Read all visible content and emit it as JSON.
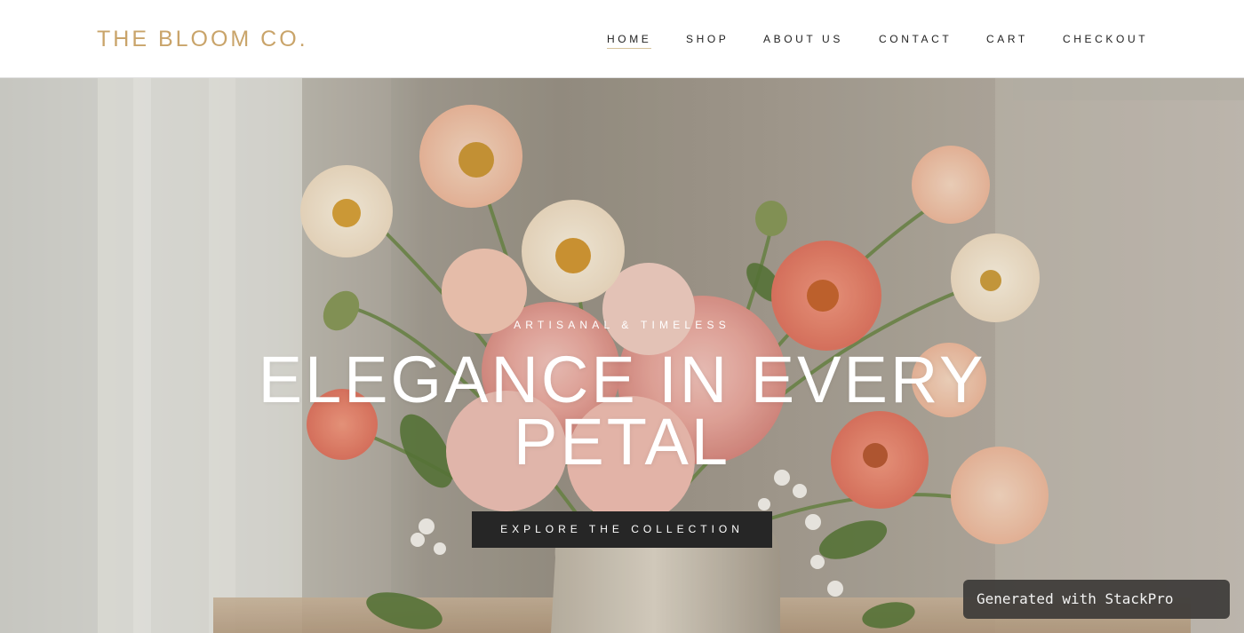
{
  "brand": {
    "name": "THE BLOOM CO.",
    "color": "#c9a46a"
  },
  "nav": {
    "items": [
      {
        "label": "HOME",
        "active": true
      },
      {
        "label": "SHOP",
        "active": false
      },
      {
        "label": "ABOUT US",
        "active": false
      },
      {
        "label": "CONTACT",
        "active": false
      },
      {
        "label": "CART",
        "active": false
      },
      {
        "label": "CHECKOUT",
        "active": false
      }
    ]
  },
  "hero": {
    "eyebrow": "ARTISANAL & TIMELESS",
    "headline_line1": "ELEGANCE IN EVERY",
    "headline_line2": "PETAL",
    "cta_label": "EXPLORE THE COLLECTION",
    "image": "flower-bouquet-photo"
  },
  "badge": {
    "label": "Generated with StackPro"
  }
}
